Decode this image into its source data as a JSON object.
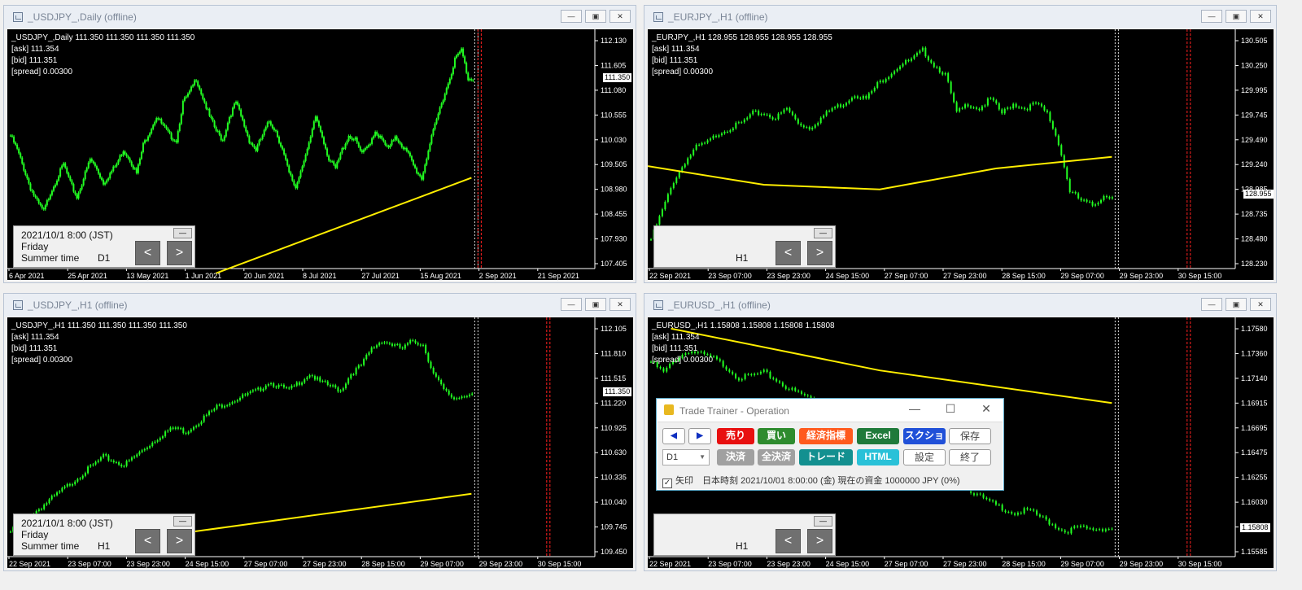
{
  "colors": {
    "candle": "#22ff22",
    "ma": "#ffee00",
    "period_sep": "#ff2020",
    "cursor": "#dddddd",
    "bg": "#000000"
  },
  "windows": [
    {
      "id": "w1",
      "title": "_USDJPY_,Daily (offline)",
      "header": "_USDJPY_,Daily  111.350 111.350 111.350 111.350",
      "ask": "[ask] 111.354",
      "bid": "[bid] 111.351",
      "spread": "[spread] 0.00300",
      "y_ticks": [
        "112.130",
        "111.605",
        "111.080",
        "110.555",
        "110.030",
        "109.505",
        "108.980",
        "108.455",
        "107.930",
        "107.405"
      ],
      "x_ticks": [
        "6 Apr 2021",
        "25 Apr 2021",
        "13 May 2021",
        "1 Jun 2021",
        "20 Jun 2021",
        "8 Jul 2021",
        "27 Jul 2021",
        "15 Aug 2021",
        "2 Sep 2021",
        "21 Sep 2021"
      ],
      "price_label": "111.350",
      "info": {
        "date": "2021/10/1 8:00 (JST)",
        "day": "Friday",
        "summer": "Summer time",
        "tf": "D1"
      },
      "series": {
        "y_range": [
          107.4,
          112.3
        ],
        "closes": [
          110.2,
          109.9,
          109.5,
          109.1,
          108.8,
          108.6,
          109.0,
          109.3,
          109.6,
          109.2,
          108.9,
          109.3,
          109.7,
          109.5,
          109.2,
          109.4,
          109.6,
          109.9,
          109.7,
          109.4,
          110.0,
          110.3,
          110.6,
          110.4,
          110.2,
          110.1,
          110.9,
          111.1,
          111.4,
          111.0,
          110.6,
          110.3,
          110.1,
          110.6,
          110.9,
          110.5,
          110.1,
          109.9,
          110.2,
          110.5,
          110.3,
          109.9,
          109.4,
          109.1,
          109.6,
          110.0,
          110.6,
          110.2,
          109.7,
          109.5,
          109.9,
          110.2,
          110.1,
          109.8,
          110.0,
          110.3,
          110.1,
          109.9,
          110.2,
          110.0,
          109.8,
          109.5,
          109.3,
          109.9,
          110.4,
          110.9,
          111.3,
          111.8,
          112.0,
          111.4
        ],
        "ma": [
          [
            0.45,
            1.02
          ],
          [
            1.0,
            0.61
          ]
        ]
      }
    },
    {
      "id": "w2",
      "title": "_EURJPY_,H1 (offline)",
      "header": "_EURJPY_,H1  128.955 128.955 128.955 128.955",
      "ask": "[ask] 111.354",
      "bid": "[bid] 111.351",
      "spread": "[spread] 0.00300",
      "y_ticks": [
        "130.505",
        "130.250",
        "129.995",
        "129.745",
        "129.490",
        "129.240",
        "128.985",
        "128.735",
        "128.480",
        "128.230"
      ],
      "x_ticks": [
        "22 Sep 2021",
        "23 Sep 07:00",
        "23 Sep 23:00",
        "24 Sep 15:00",
        "27 Sep 07:00",
        "27 Sep 23:00",
        "28 Sep 15:00",
        "29 Sep 07:00",
        "29 Sep 23:00",
        "30 Sep 15:00"
      ],
      "price_label": "128.955",
      "info": {
        "date": "",
        "day": "",
        "summer": "",
        "tf": "H1"
      },
      "series": {
        "y_range": [
          128.2,
          130.6
        ],
        "closes": [
          128.5,
          128.8,
          129.1,
          129.3,
          129.45,
          129.5,
          129.6,
          129.65,
          129.7,
          129.8,
          129.8,
          129.75,
          129.85,
          129.7,
          129.65,
          129.75,
          129.85,
          129.9,
          130.0,
          129.95,
          130.1,
          130.2,
          130.3,
          130.35,
          130.45,
          130.3,
          130.2,
          129.8,
          129.9,
          129.85,
          129.95,
          129.8,
          129.9,
          129.85,
          129.9,
          129.8,
          129.5,
          129.0,
          128.9,
          128.85,
          128.95
        ],
        "ma": [
          [
            0.0,
            0.56
          ],
          [
            0.25,
            0.64
          ],
          [
            0.5,
            0.66
          ],
          [
            0.75,
            0.57
          ],
          [
            1.0,
            0.52
          ]
        ]
      }
    },
    {
      "id": "w3",
      "title": "_USDJPY_,H1 (offline)",
      "header": "_USDJPY_,H1  111.350 111.350 111.350 111.350",
      "ask": "[ask] 111.354",
      "bid": "[bid] 111.351",
      "spread": "[spread] 0.00300",
      "y_ticks": [
        "112.105",
        "111.810",
        "111.515",
        "111.220",
        "110.925",
        "110.630",
        "110.335",
        "110.040",
        "109.745",
        "109.450"
      ],
      "x_ticks": [
        "22 Sep 2021",
        "23 Sep 07:00",
        "23 Sep 23:00",
        "24 Sep 15:00",
        "27 Sep 07:00",
        "27 Sep 23:00",
        "28 Sep 15:00",
        "29 Sep 07:00",
        "29 Sep 23:00",
        "30 Sep 15:00"
      ],
      "price_label": "111.350",
      "info": {
        "date": "2021/10/1 8:00 (JST)",
        "day": "Friday",
        "summer": "Summer time",
        "tf": "H1"
      },
      "series": {
        "y_range": [
          109.4,
          112.2
        ],
        "closes": [
          109.7,
          109.8,
          109.9,
          110.0,
          110.1,
          110.2,
          110.3,
          110.4,
          110.5,
          110.6,
          110.55,
          110.5,
          110.6,
          110.7,
          110.8,
          110.9,
          110.95,
          110.9,
          111.0,
          111.1,
          111.2,
          111.25,
          111.3,
          111.35,
          111.4,
          111.5,
          111.45,
          111.4,
          111.5,
          111.6,
          111.5,
          111.45,
          111.4,
          111.6,
          111.7,
          111.9,
          112.0,
          111.95,
          111.9,
          112.0,
          111.95,
          111.6,
          111.4,
          111.3,
          111.35
        ],
        "ma": [
          [
            0.3,
            0.92
          ],
          [
            1.0,
            0.73
          ]
        ]
      }
    },
    {
      "id": "w4",
      "title": "_EURUSD_,H1 (offline)",
      "header": "_EURUSD_,H1  1.15808 1.15808 1.15808 1.15808",
      "ask": "[ask] 111.354",
      "bid": "[bid] 111.351",
      "spread": "[spread] 0.00300",
      "y_ticks": [
        "1.17580",
        "1.17360",
        "1.17140",
        "1.16915",
        "1.16695",
        "1.16475",
        "1.16255",
        "1.16030",
        "1.15810",
        "1.15585"
      ],
      "x_ticks": [
        "22 Sep 2021",
        "23 Sep 07:00",
        "23 Sep 23:00",
        "24 Sep 15:00",
        "27 Sep 07:00",
        "27 Sep 23:00",
        "28 Sep 15:00",
        "29 Sep 07:00",
        "29 Sep 23:00",
        "30 Sep 15:00"
      ],
      "price_label": "1.15808",
      "info": {
        "date": "",
        "day": "",
        "summer": "",
        "tf": "H1"
      },
      "series": {
        "y_range": [
          1.1555,
          1.177
        ],
        "closes": [
          1.1735,
          1.1725,
          1.1738,
          1.1745,
          1.1742,
          1.1738,
          1.173,
          1.172,
          1.1722,
          1.1725,
          1.1718,
          1.171,
          1.1705,
          1.17,
          1.1698,
          1.1692,
          1.1688,
          1.168,
          1.1672,
          1.1665,
          1.166,
          1.1655,
          1.165,
          1.164,
          1.163,
          1.162,
          1.1612,
          1.1605,
          1.16,
          1.1595,
          1.1598,
          1.1592,
          1.1585,
          1.1578,
          1.1582,
          1.158,
          1.1581
        ],
        "ma": [
          [
            0.05,
            0.02
          ],
          [
            0.5,
            0.2
          ],
          [
            1.0,
            0.34
          ]
        ]
      }
    }
  ],
  "dialog": {
    "title": "Trade Trainer - Operation",
    "buttons": {
      "prev": "◀",
      "next": "▶",
      "sell": "売り",
      "buy": "買い",
      "econ": "経済指標",
      "excel": "Excel",
      "screenshot": "スクショ",
      "save": "保存",
      "close_pos": "決済",
      "close_all": "全決済",
      "trade": "トレード",
      "html": "HTML",
      "settings": "設定",
      "end": "終了"
    },
    "timeframe": "D1",
    "arrow_label": "矢印",
    "status": "日本時刻 2021/10/01 8:00:00 (金)    現在の資金 1000000 JPY (0%)"
  }
}
